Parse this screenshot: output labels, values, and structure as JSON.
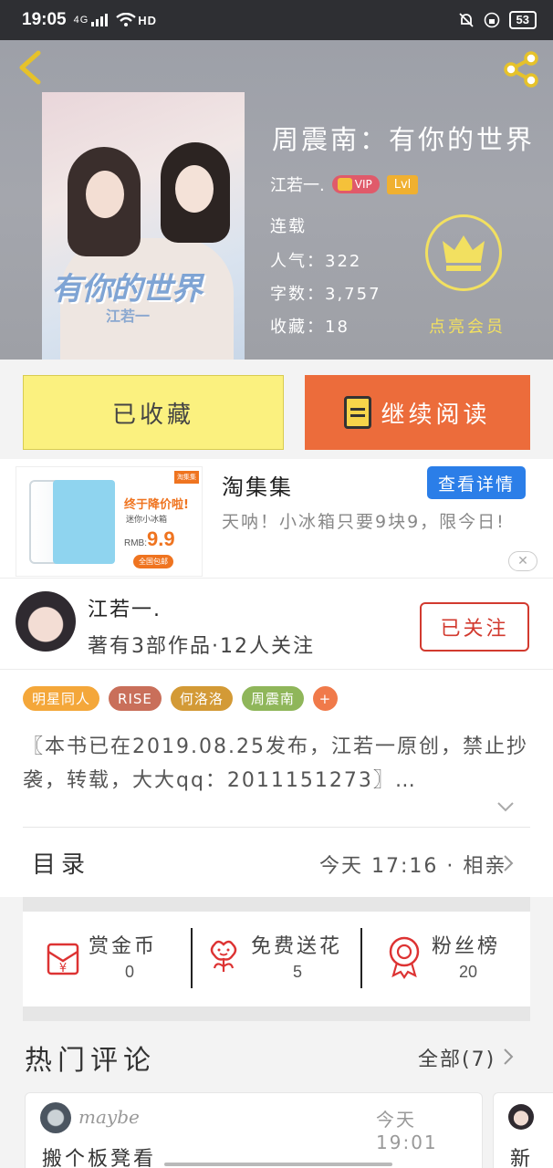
{
  "status_bar": {
    "time": "19:05",
    "network": "4G",
    "hd": "HD",
    "battery": "53"
  },
  "book": {
    "title": "周震南：有你的世界",
    "cover_title": "有你的世界",
    "cover_subtitle": "江若一",
    "author": "江若一.",
    "vip_badge": "VIP",
    "level_badge": "Lvl",
    "status": "连载",
    "popularity_label": "人气：",
    "popularity": "322",
    "word_count_label": "字数：",
    "word_count": "3,757",
    "favorites_label": "收藏：",
    "favorites": "18",
    "vip_cta": "点亮会员"
  },
  "actions": {
    "collected_label": "已收藏",
    "continue_label": "继续阅读"
  },
  "ad": {
    "promo_title": "终于降价啦!",
    "promo_sub": "迷你小冰箱",
    "price_prefix": "RMB:",
    "price": "9.9",
    "shipping": "全国包邮",
    "corner": "淘集集",
    "advertiser": "淘集集",
    "detail_button": "查看详情",
    "description": "天呐！小冰箱只要9块9，限今日!"
  },
  "author_card": {
    "name": "江若一.",
    "stats": "著有3部作品·12人关注",
    "follow_label": "已关注"
  },
  "tags": [
    {
      "label": "明星同人",
      "color": "#f4a73a"
    },
    {
      "label": "RISE",
      "color": "#c96f5a"
    },
    {
      "label": "何洛洛",
      "color": "#d39a36"
    },
    {
      "label": "周震南",
      "color": "#8fb65a"
    },
    {
      "label": "+",
      "color": "#f07a4a"
    }
  ],
  "synopsis": "〖本书已在2019.08.25发布，江若一原创，禁止抄袭，转载，大大qq：2011151273〗…",
  "toc": {
    "label": "目录",
    "update": "今天 17:16 · 相亲"
  },
  "rewards": [
    {
      "title": "赏金币",
      "count": "0",
      "icon": "red-envelope-icon"
    },
    {
      "title": "免费送花",
      "count": "5",
      "icon": "flower-icon"
    },
    {
      "title": "粉丝榜",
      "count": "20",
      "icon": "medal-icon"
    }
  ],
  "comments": {
    "title": "热门评论",
    "all_label": "全部(7)",
    "items": [
      {
        "user": "maybe",
        "time": "今天 19:01",
        "text": "搬个板凳看"
      },
      {
        "user": "",
        "time": "",
        "text": "新"
      }
    ]
  },
  "colors": {
    "accent_orange": "#ec6c3b",
    "collect_yellow": "#fbf17f",
    "follow_red": "#d23a2f",
    "detail_blue": "#2b7ee8",
    "vip_yellow": "#f2e060"
  }
}
